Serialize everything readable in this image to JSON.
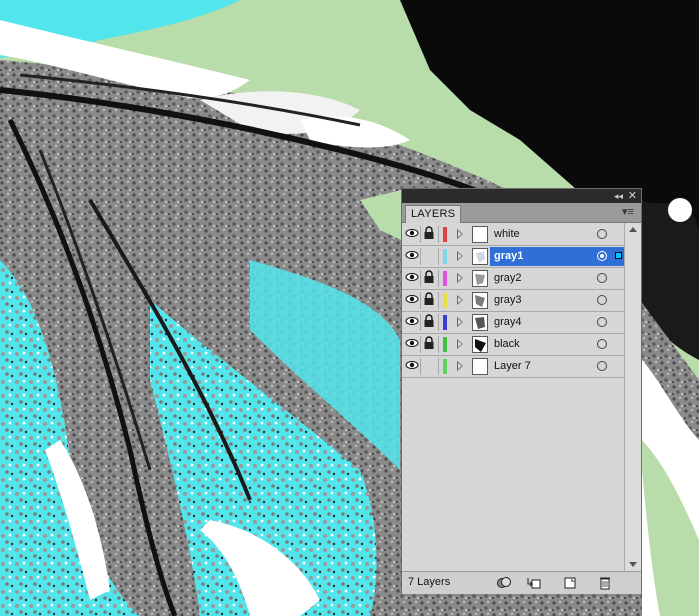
{
  "panel": {
    "tab_label": "LAYERS",
    "collapse_glyph": "◂◂",
    "close_glyph": "✕",
    "menu_glyph": "▾≡",
    "layer_count": "7 Layers",
    "footer_icons": [
      "make-clipping-mask-icon",
      "create-new-sublayer-icon",
      "create-new-layer-icon",
      "delete-layer-icon"
    ]
  },
  "layers": [
    {
      "name": "white",
      "color": "#e04040",
      "visible": true,
      "locked": true,
      "selected": false,
      "thumb": "white"
    },
    {
      "name": "gray1",
      "color": "#7fd6e8",
      "visible": true,
      "locked": false,
      "selected": true,
      "thumb": "gray1"
    },
    {
      "name": "gray2",
      "color": "#e050e0",
      "visible": true,
      "locked": true,
      "selected": false,
      "thumb": "gray2"
    },
    {
      "name": "gray3",
      "color": "#e8e040",
      "visible": true,
      "locked": true,
      "selected": false,
      "thumb": "gray3"
    },
    {
      "name": "gray4",
      "color": "#3c3cd8",
      "visible": true,
      "locked": true,
      "selected": false,
      "thumb": "gray4"
    },
    {
      "name": "black",
      "color": "#40c040",
      "visible": true,
      "locked": true,
      "selected": false,
      "thumb": "black"
    },
    {
      "name": "Layer 7",
      "color": "#60d060",
      "visible": true,
      "locked": false,
      "selected": false,
      "thumb": "empty"
    }
  ],
  "colors": {
    "canvas_green": "#b8dcaa",
    "cyan": "#52e6ec",
    "selection_blue": "#2f6fd6"
  }
}
